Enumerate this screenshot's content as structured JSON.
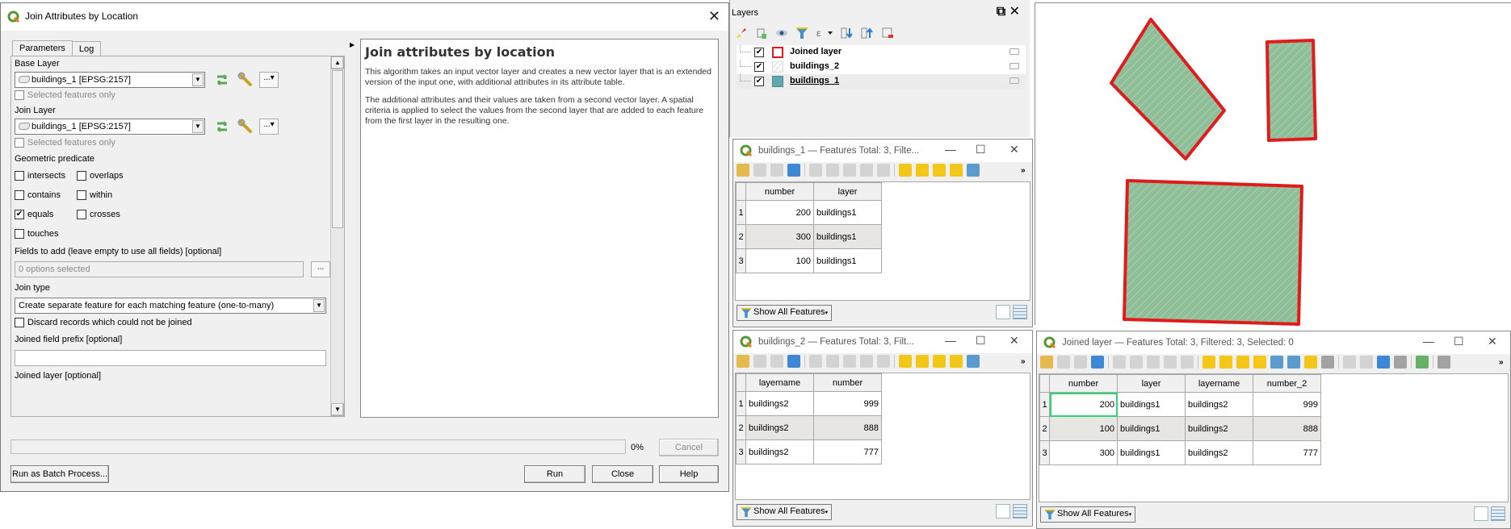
{
  "dialog": {
    "title": "Join Attributes by Location",
    "tabs": [
      {
        "label": "Parameters",
        "active": true
      },
      {
        "label": "Log",
        "active": false
      }
    ],
    "params": {
      "base_layer_label": "Base Layer",
      "base_layer_value": "buildings_1 [EPSG:2157]",
      "base_selected_only": "Selected features only",
      "join_layer_label": "Join Layer",
      "join_layer_value": "buildings_1 [EPSG:2157]",
      "join_selected_only": "Selected features only",
      "predicate_label": "Geometric predicate",
      "predicates": [
        {
          "label": "intersects",
          "checked": false
        },
        {
          "label": "overlaps",
          "checked": false
        },
        {
          "label": "contains",
          "checked": false
        },
        {
          "label": "within",
          "checked": false
        },
        {
          "label": "equals",
          "checked": true
        },
        {
          "label": "crosses",
          "checked": false
        },
        {
          "label": "touches",
          "checked": false
        }
      ],
      "fields_label": "Fields to add (leave empty to use all fields) [optional]",
      "fields_placeholder": "0 options selected",
      "join_type_label": "Join type",
      "join_type_value": "Create separate feature for each matching feature (one-to-many)",
      "discard_label": "Discard records which could not be joined",
      "discard_checked": false,
      "prefix_label": "Joined field prefix [optional]",
      "prefix_value": "",
      "joined_layer_label": "Joined layer [optional]",
      "dots": "...",
      "more": "...▾"
    },
    "help": {
      "title": "Join attributes by location",
      "p1": "This algorithm takes an input vector layer and creates a new vector layer that is an extended version of the input one, with additional attributes in its attribute table.",
      "p2": "The additional attributes and their values are taken from a second vector layer. A spatial criteria is applied to select the values from the second layer that are added to each feature from the first layer in the resulting one."
    },
    "progress": {
      "percent": 0,
      "text": "0%"
    },
    "buttons": {
      "cancel": "Cancel",
      "batch": "Run as Batch Process...",
      "run": "Run",
      "close": "Close",
      "help": "Help"
    }
  },
  "layers_panel": {
    "title": "Layers",
    "toolbar_icons": [
      "style-icon",
      "add-group-icon",
      "visibility-icon",
      "filter-icon",
      "expression-icon",
      "expand-icon",
      "collapse-icon",
      "remove-icon"
    ],
    "layers": [
      {
        "name": "Joined layer",
        "checked": true,
        "symbol": "red-outline"
      },
      {
        "name": "buildings_2",
        "checked": true,
        "symbol": "hatched"
      },
      {
        "name": "buildings_1",
        "checked": true,
        "symbol": "teal-fill",
        "selected": true
      }
    ]
  },
  "attr_tables": [
    {
      "title": "buildings_1 — Features Total: 3, Filte...",
      "columns": [
        "number",
        "layer"
      ],
      "numeric": [
        true,
        false
      ],
      "rows": [
        [
          "200",
          "buildings1"
        ],
        [
          "300",
          "buildings1"
        ],
        [
          "100",
          "buildings1"
        ]
      ],
      "filter_label": "Show All Features"
    },
    {
      "title": "buildings_2 — Features Total: 3, Filt...",
      "columns": [
        "layername",
        "number"
      ],
      "numeric": [
        false,
        true
      ],
      "rows": [
        [
          "buildings2",
          "999"
        ],
        [
          "buildings2",
          "888"
        ],
        [
          "buildings2",
          "777"
        ]
      ],
      "filter_label": "Show All Features"
    },
    {
      "title": "Joined layer — Features Total: 3, Filtered: 3, Selected: 0",
      "columns": [
        "number",
        "layer",
        "layername",
        "number_2"
      ],
      "numeric": [
        true,
        false,
        false,
        true
      ],
      "rows": [
        [
          "200",
          "buildings1",
          "buildings2",
          "999"
        ],
        [
          "100",
          "buildings1",
          "buildings2",
          "888"
        ],
        [
          "300",
          "buildings1",
          "buildings2",
          "777"
        ]
      ],
      "filter_label": "Show All Features"
    }
  ],
  "window_controls": {
    "minimize": "—",
    "maximize": "☐",
    "close": "✕",
    "more": "»"
  },
  "map": {
    "fill_color": "#8fbf98",
    "stroke_color": "#e31a1c",
    "features": [
      "building-rotated",
      "building-small",
      "building-large"
    ]
  }
}
